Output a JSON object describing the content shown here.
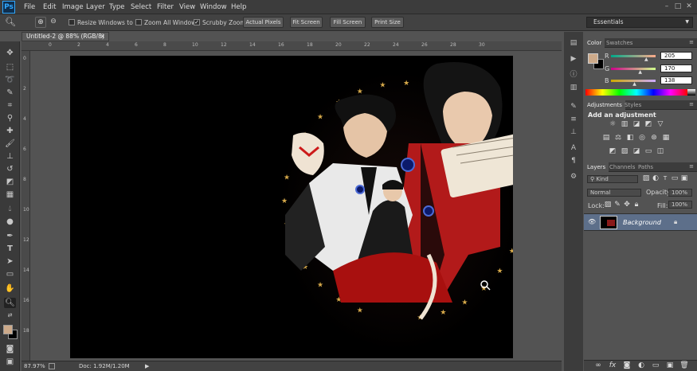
{
  "app": {
    "logo": "Ps"
  },
  "menu": [
    "File",
    "Edit",
    "Image",
    "Layer",
    "Type",
    "Select",
    "Filter",
    "View",
    "Window",
    "Help"
  ],
  "window_controls": {
    "minimize": "–",
    "maximize": "□",
    "close": "✕"
  },
  "options": {
    "resize_windows": "Resize Windows to Fit",
    "zoom_all_windows": "Zoom All Windows",
    "scrubby_zoom": "Scrubby Zoom",
    "actual_pixels": "Actual Pixels",
    "fit_screen": "Fit Screen",
    "fill_screen": "Fill Screen",
    "print_size": "Print Size",
    "workspace": "Essentials"
  },
  "document": {
    "tab_title": "Untitled-2 @ 88% (RGB/8) *",
    "close": "×"
  },
  "status": {
    "zoom": "87.97%",
    "doc": "Doc: 1.92M/1.20M"
  },
  "ruler_top_marks": [
    "0",
    "2",
    "4",
    "6",
    "8",
    "10",
    "12",
    "14",
    "16",
    "18",
    "20",
    "22",
    "24",
    "26",
    "28",
    "30"
  ],
  "ruler_left_marks": [
    "0",
    "2",
    "4",
    "6",
    "8",
    "10",
    "12",
    "14",
    "16",
    "18"
  ],
  "color_panel": {
    "tabs": [
      "Color",
      "Swatches"
    ],
    "r_label": "R",
    "g_label": "G",
    "b_label": "B",
    "r": "205",
    "g": "170",
    "b": "138",
    "fg_color": "#cdaa8a",
    "bg_color": "#000000"
  },
  "adjustments_panel": {
    "tabs": [
      "Adjustments",
      "Styles"
    ],
    "heading": "Add an adjustment"
  },
  "layers_panel": {
    "tabs": [
      "Layers",
      "Channels",
      "Paths"
    ],
    "filter_kind": "Kind",
    "blend_mode": "Normal",
    "opacity_label": "Opacity:",
    "opacity_value": "100%",
    "lock_label": "Lock:",
    "fill_label": "Fill:",
    "fill_value": "100%",
    "layers": [
      {
        "name": "Background"
      }
    ]
  }
}
